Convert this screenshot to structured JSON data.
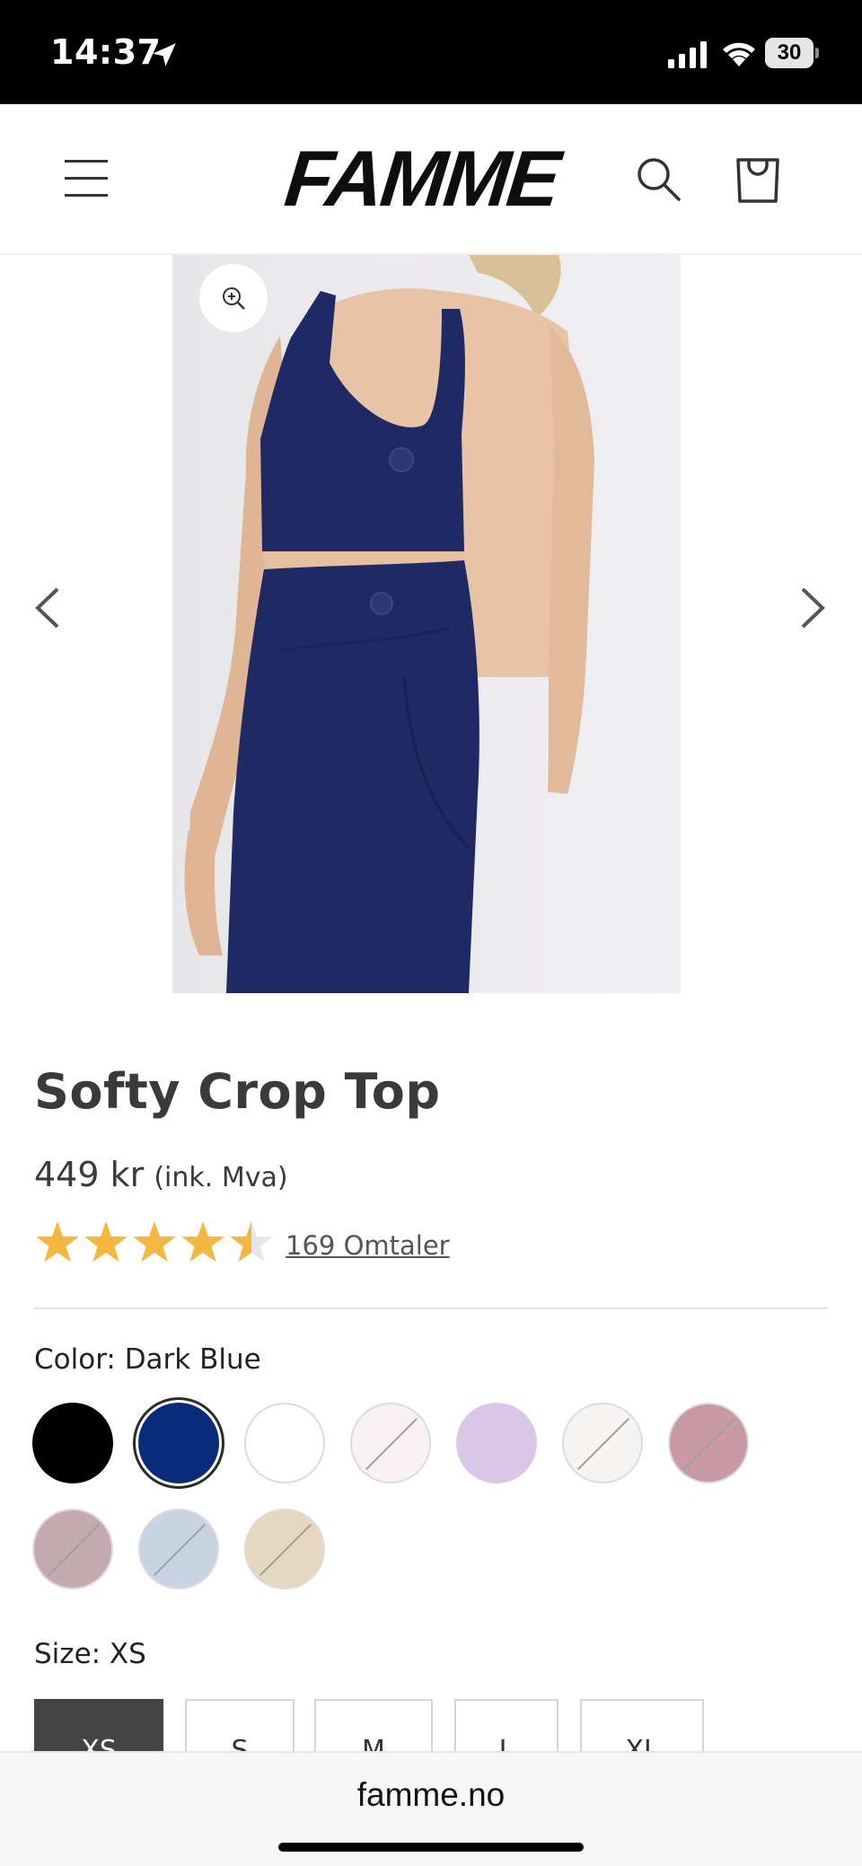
{
  "status_bar": {
    "time": "14:37",
    "battery": "30"
  },
  "header": {
    "logo": "FAMME"
  },
  "product": {
    "title": "Softy Crop Top",
    "price": "449 kr",
    "price_note": "(ink. Mva)",
    "rating": 4.5,
    "reviews_label": "169 Omtaler",
    "color_label": "Color: Dark Blue",
    "size_label": "Size: XS",
    "swatches": [
      {
        "name": "black",
        "color": "#000000",
        "available": true
      },
      {
        "name": "dark-blue",
        "color": "#0a2a7c",
        "available": true,
        "selected": true
      },
      {
        "name": "white",
        "color": "#ffffff",
        "available": true
      },
      {
        "name": "light-pink",
        "color": "#faf1f4",
        "available": false
      },
      {
        "name": "lilac",
        "color": "#dac7e8",
        "available": true
      },
      {
        "name": "off-white",
        "color": "#f6f4f2",
        "available": false
      },
      {
        "name": "dusty-rose",
        "color": "#c99aa6",
        "available": false
      },
      {
        "name": "mauve",
        "color": "#c5abb1",
        "available": false
      },
      {
        "name": "light-blue",
        "color": "#c8d4e1",
        "available": false
      },
      {
        "name": "beige",
        "color": "#e6d7c1",
        "available": false
      }
    ],
    "sizes": [
      {
        "label": "XS",
        "selected": true
      },
      {
        "label": "S",
        "selected": false
      },
      {
        "label": "M",
        "selected": false
      },
      {
        "label": "L",
        "selected": false
      },
      {
        "label": "XL",
        "selected": false
      }
    ]
  },
  "browser": {
    "url": "famme.no"
  },
  "colors": {
    "star": "#f4b73f",
    "star_empty": "#e6e6e6",
    "garment": "#1f2a64"
  }
}
